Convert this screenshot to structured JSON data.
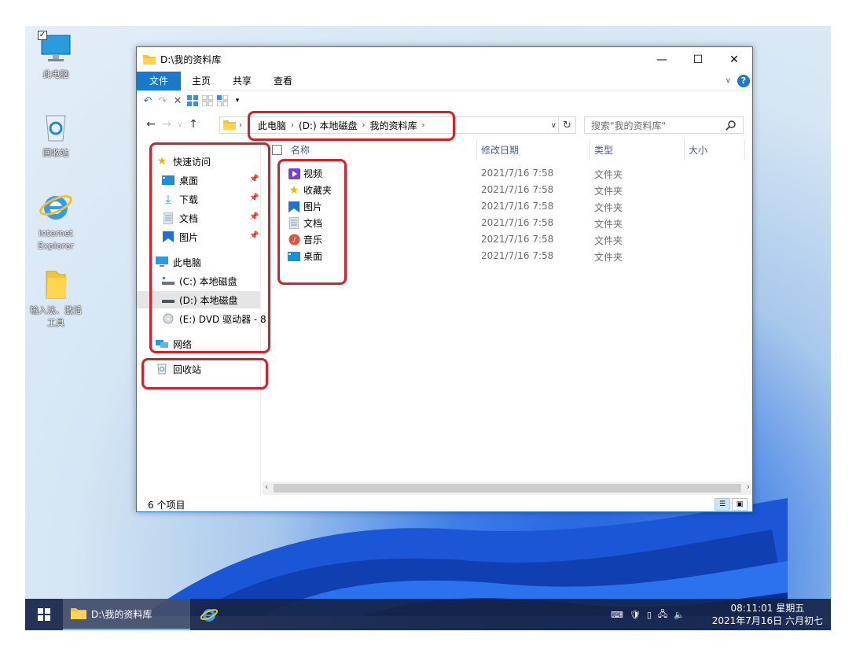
{
  "desktop": {
    "icons": [
      {
        "label": "此电脑",
        "icon": "computer-icon"
      },
      {
        "label": "回收站",
        "icon": "recycle-bin-icon"
      },
      {
        "label_line1": "Internet",
        "label_line2": "Explorer",
        "icon": "ie-icon"
      },
      {
        "label_line1": "输入法、激活",
        "label_line2": "工具",
        "icon": "folder-icon"
      }
    ]
  },
  "window": {
    "title": "D:\\我的资料库",
    "controls": {
      "minimize": "—",
      "maximize": "☐",
      "close": "✕"
    }
  },
  "ribbon": {
    "tabs": [
      "文件",
      "主页",
      "共享",
      "查看"
    ],
    "help": "?"
  },
  "address": {
    "crumbs": [
      "此电脑",
      "(D:) 本地磁盘",
      "我的资料库"
    ],
    "search_placeholder": "搜索\"我的资料库\""
  },
  "navpane": {
    "quick_access": "快速访问",
    "quick_items": [
      "桌面",
      "下载",
      "文档",
      "图片"
    ],
    "this_pc": "此电脑",
    "drives": [
      "(C:) 本地磁盘",
      "(D:) 本地磁盘",
      "(E:) DVD 驱动器 - 8"
    ],
    "network": "网络",
    "recycle": "回收站"
  },
  "columns": {
    "name": "名称",
    "date": "修改日期",
    "type": "类型",
    "size": "大小"
  },
  "files": [
    {
      "name": "视频",
      "date": "2021/7/16 7:58",
      "type": "文件夹",
      "icon": "video-folder-icon",
      "color": "#7b3fd6"
    },
    {
      "name": "收藏夹",
      "date": "2021/7/16 7:58",
      "type": "文件夹",
      "icon": "star-icon",
      "color": "#f2b400"
    },
    {
      "name": "图片",
      "date": "2021/7/16 7:58",
      "type": "文件夹",
      "icon": "pictures-icon",
      "color": "#1f74c9"
    },
    {
      "name": "文档",
      "date": "2021/7/16 7:58",
      "type": "文件夹",
      "icon": "document-icon",
      "color": "#8a9bb0"
    },
    {
      "name": "音乐",
      "date": "2021/7/16 7:58",
      "type": "文件夹",
      "icon": "music-icon",
      "color": "#e0533e"
    },
    {
      "name": "桌面",
      "date": "2021/7/16 7:58",
      "type": "文件夹",
      "icon": "desktop-icon",
      "color": "#1b8fd8"
    }
  ],
  "status": {
    "count": "6 个项目"
  },
  "taskbar": {
    "app_label": "D:\\我的资料库",
    "time": "08:11:01 星期五",
    "date": "2021年7月16日 六月初七"
  },
  "colors": {
    "accent": "#1979ca",
    "highlight": "#d8202a",
    "taskbar": "#162448"
  }
}
